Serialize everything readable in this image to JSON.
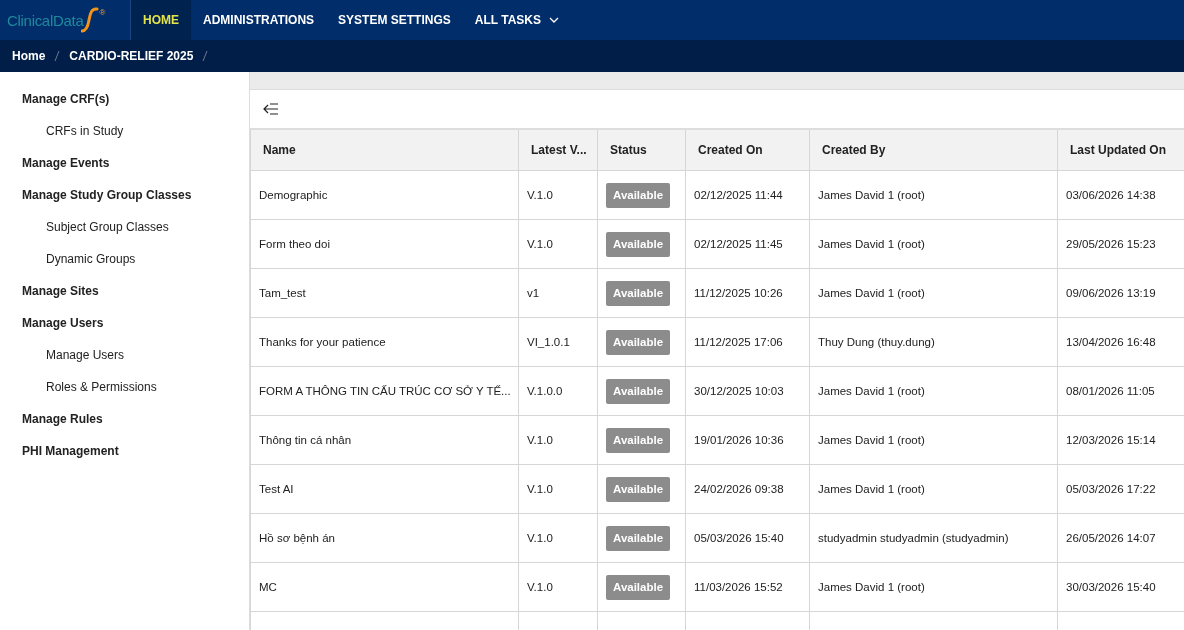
{
  "logo": {
    "text": "ClinicalData",
    "mark": "®"
  },
  "nav": [
    {
      "label": "HOME",
      "selected": true,
      "dropdown": false
    },
    {
      "label": "ADMINISTRATIONS",
      "selected": false,
      "dropdown": false
    },
    {
      "label": "SYSTEM SETTINGS",
      "selected": false,
      "dropdown": false
    },
    {
      "label": "ALL TASKS",
      "selected": false,
      "dropdown": true
    }
  ],
  "breadcrumb": [
    "Home",
    "CARDIO-RELIEF 2025"
  ],
  "sidebar": {
    "items": [
      {
        "label": "Manage CRF(s)",
        "children": [
          {
            "label": "CRFs in Study"
          }
        ]
      },
      {
        "label": "Manage Events"
      },
      {
        "label": "Manage Study Group Classes",
        "children": [
          {
            "label": "Subject Group Classes"
          },
          {
            "label": "Dynamic Groups"
          }
        ]
      },
      {
        "label": "Manage Sites"
      },
      {
        "label": "Manage Users",
        "children": [
          {
            "label": "Manage Users"
          },
          {
            "label": "Roles & Permissions"
          }
        ]
      },
      {
        "label": "Manage Rules"
      },
      {
        "label": "PHI Management"
      }
    ]
  },
  "table": {
    "columns": [
      "Name",
      "Latest V...",
      "Status",
      "Created On",
      "Created By",
      "Last Updated On"
    ],
    "rows": [
      {
        "name": "Demographic",
        "version": "V.1.0",
        "status": "Available",
        "created_on": "02/12/2025 11:44",
        "created_by": "James David 1 (root)",
        "updated_on": "03/06/2026 14:38"
      },
      {
        "name": "Form theo doi",
        "version": "V.1.0",
        "status": "Available",
        "created_on": "02/12/2025 11:45",
        "created_by": "James David 1 (root)",
        "updated_on": "29/05/2026 15:23"
      },
      {
        "name": "Tam_test",
        "version": "v1",
        "status": "Available",
        "created_on": "11/12/2025 10:26",
        "created_by": "James David 1 (root)",
        "updated_on": "09/06/2026 13:19"
      },
      {
        "name": "Thanks for your patience",
        "version": "VI_1.0.1",
        "status": "Available",
        "created_on": "11/12/2025 17:06",
        "created_by": "Thuy Dung (thuy.dung)",
        "updated_on": "13/04/2026 16:48"
      },
      {
        "name": "FORM A THÔNG TIN CẤU TRÚC CƠ SỞ Y TẾ...",
        "version": "V.1.0.0",
        "status": "Available",
        "created_on": "30/12/2025 10:03",
        "created_by": "James David 1 (root)",
        "updated_on": "08/01/2026 11:05"
      },
      {
        "name": "Thông tin cá nhân",
        "version": "V.1.0",
        "status": "Available",
        "created_on": "19/01/2026 10:36",
        "created_by": "James David 1 (root)",
        "updated_on": "12/03/2026 15:14"
      },
      {
        "name": "Test AI",
        "version": "V.1.0",
        "status": "Available",
        "created_on": "24/02/2026 09:38",
        "created_by": "James David 1 (root)",
        "updated_on": "05/03/2026 17:22"
      },
      {
        "name": "Hồ sơ bệnh án",
        "version": "V.1.0",
        "status": "Available",
        "created_on": "05/03/2026 15:40",
        "created_by": "studyadmin studyadmin (studyadmin)",
        "updated_on": "26/05/2026 14:07"
      },
      {
        "name": "MC",
        "version": "V.1.0",
        "status": "Available",
        "created_on": "11/03/2026 15:52",
        "created_by": "James David 1 (root)",
        "updated_on": "30/03/2026 15:40"
      }
    ]
  }
}
